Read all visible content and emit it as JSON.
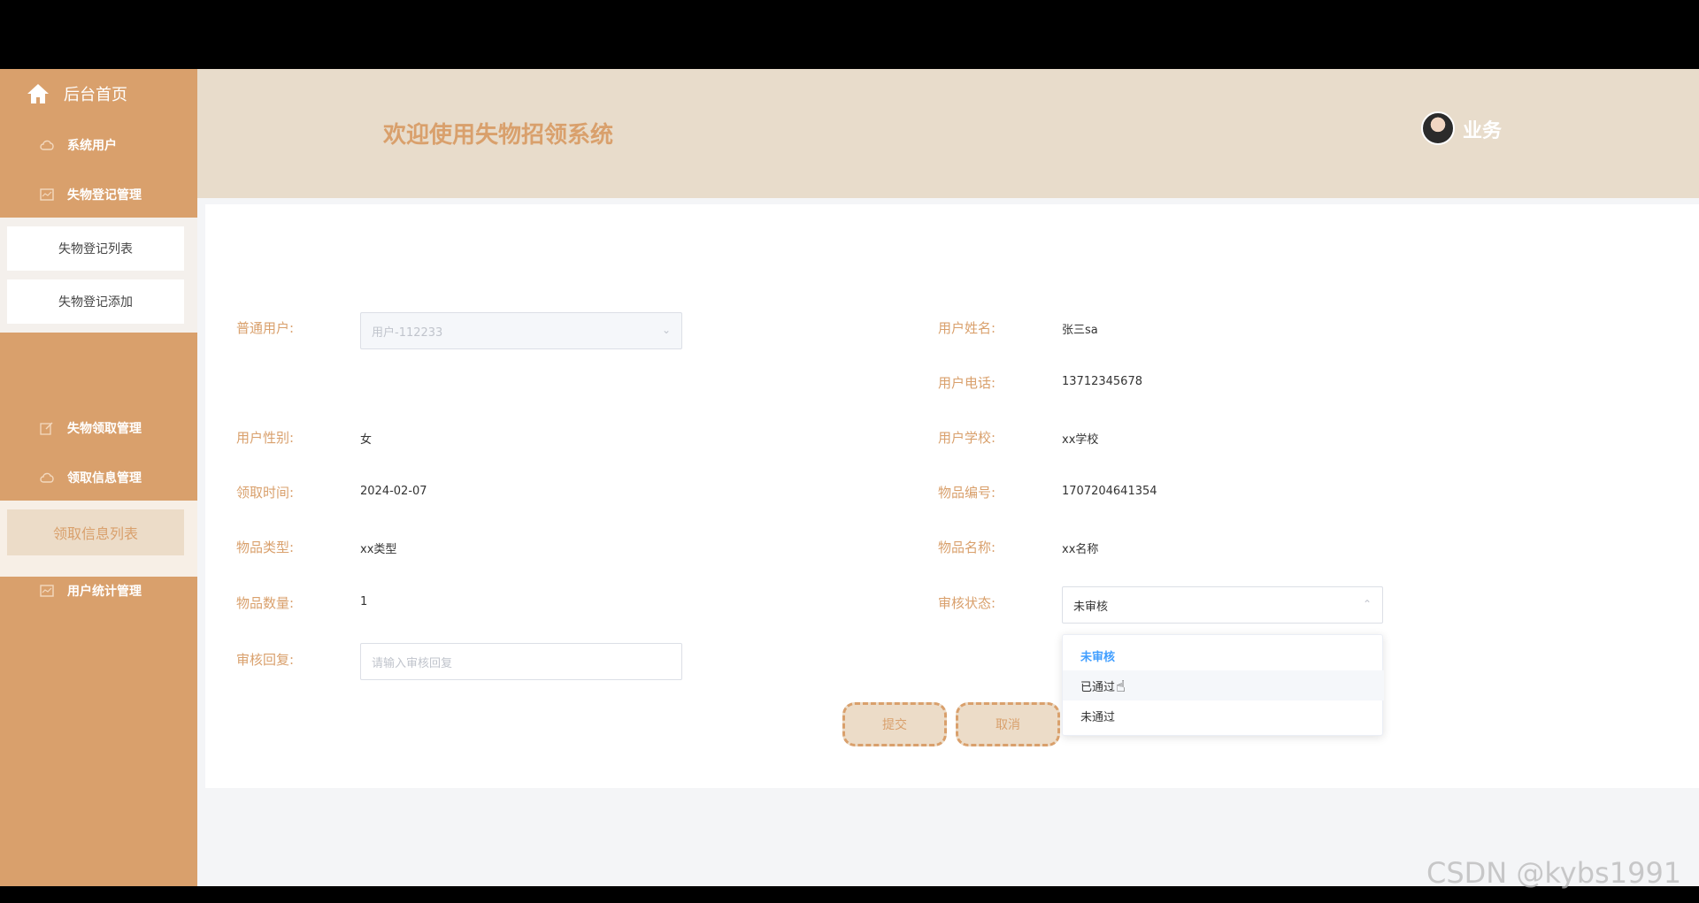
{
  "sidebar": {
    "home": "后台首页",
    "users": "系统用户",
    "lost_mgmt": "失物登记管理",
    "lost_list": "失物登记列表",
    "lost_add": "失物登记添加",
    "claim_mgmt": "失物领取管理",
    "claim_info_mgmt": "领取信息管理",
    "claim_info_list": "领取信息列表",
    "stats_mgmt": "用户统计管理"
  },
  "header": {
    "title": "欢迎使用失物招领系统",
    "username": "业务"
  },
  "form": {
    "normal_user_label": "普通用户:",
    "normal_user_value": "用户-112233",
    "user_name_label": "用户姓名:",
    "user_name_value": "张三sa",
    "user_phone_label": "用户电话:",
    "user_phone_value": "13712345678",
    "gender_label": "用户性别:",
    "gender_value": "女",
    "school_label": "用户学校:",
    "school_value": "xx学校",
    "claim_time_label": "领取时间:",
    "claim_time_value": "2024-02-07",
    "item_no_label": "物品编号:",
    "item_no_value": "1707204641354",
    "item_type_label": "物品类型:",
    "item_type_value": "xx类型",
    "item_name_label": "物品名称:",
    "item_name_value": "xx名称",
    "item_qty_label": "物品数量:",
    "item_qty_value": "1",
    "audit_status_label": "审核状态:",
    "audit_status_value": "未审核",
    "audit_reply_label": "审核回复:",
    "audit_reply_placeholder": "请输入审核回复",
    "status_options": [
      "未审核",
      "已通过",
      "未通过"
    ],
    "submit": "提交",
    "cancel": "取消"
  },
  "watermark": "CSDN @kybs1991",
  "colors": {
    "accent": "#d9a06c",
    "header_bg": "#e8dccb",
    "selected_option": "#409eff"
  }
}
